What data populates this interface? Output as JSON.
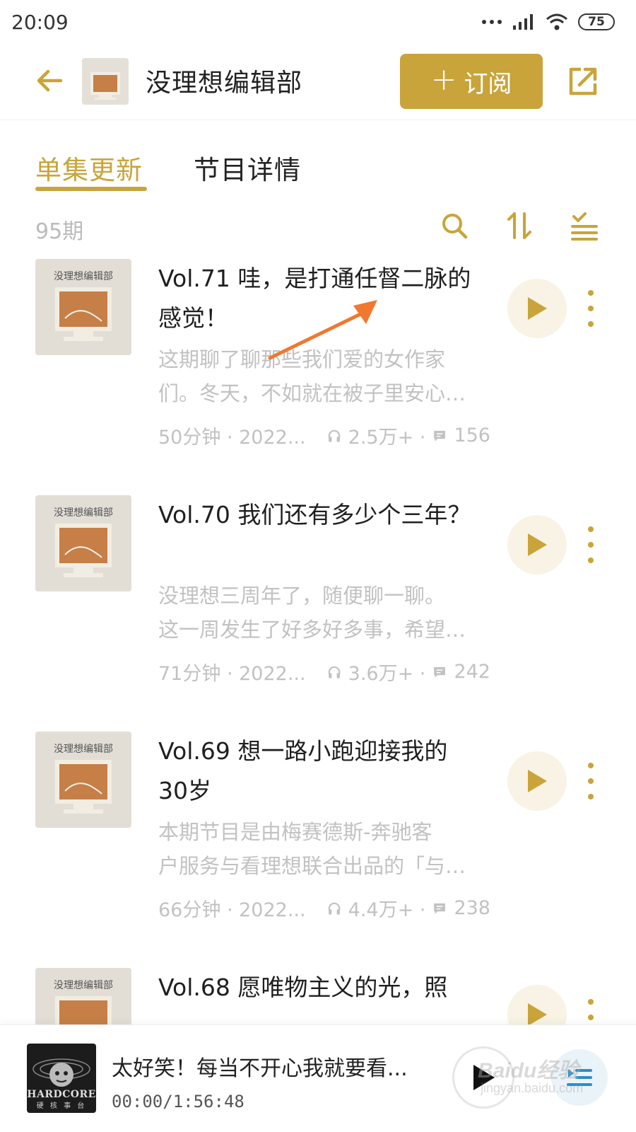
{
  "status_bar": {
    "time": "20:09",
    "battery": "75"
  },
  "header": {
    "title": "没理想编辑部",
    "subscribe_label": "订阅"
  },
  "tabs": [
    {
      "label": "单集更新",
      "active": true
    },
    {
      "label": "节目详情",
      "active": false
    }
  ],
  "toolbar": {
    "count": "95期"
  },
  "cover_label": "没理想编辑部",
  "episodes": [
    {
      "title": "Vol.71 哇，是打通任督二脉的感觉！",
      "desc_line1": "这期聊了聊那些我们爱的女作家",
      "desc_line2": "们。冬天，不如就在被子里安心…",
      "duration_date": "50分钟 · 2022...",
      "plays": "2.5万+ ·",
      "comments": "156"
    },
    {
      "title": "Vol.70 我们还有多少个三年？",
      "desc_line1": "没理想三周年了，随便聊一聊。",
      "desc_line2": "这一周发生了好多好多事，希望…",
      "duration_date": "71分钟 · 2022...",
      "plays": "3.6万+ ·",
      "comments": "242"
    },
    {
      "title": "Vol.69 想一路小跑迎接我的30岁",
      "desc_line1": "本期节目是由梅赛德斯-奔驰客",
      "desc_line2": "户服务与看理想联合出品的「与…",
      "duration_date": "66分钟 · 2022...",
      "plays": "4.4万+ ·",
      "comments": "238"
    },
    {
      "title": "Vol.68 愿唯物主义的光，照",
      "desc_line1": "",
      "desc_line2": "",
      "duration_date": "",
      "plays": "",
      "comments": ""
    }
  ],
  "player": {
    "title": "太好笑！每当不开心我就要看...",
    "time": "00:00/1:56:48",
    "cover_text": "HARDCORE",
    "cover_sub": "硬 核 事 台"
  },
  "watermark": {
    "main": "Baidu经验",
    "sub": "jingyan.baidu.com"
  },
  "colors": {
    "accent": "#c9a43a",
    "annotation": "#f07830"
  }
}
